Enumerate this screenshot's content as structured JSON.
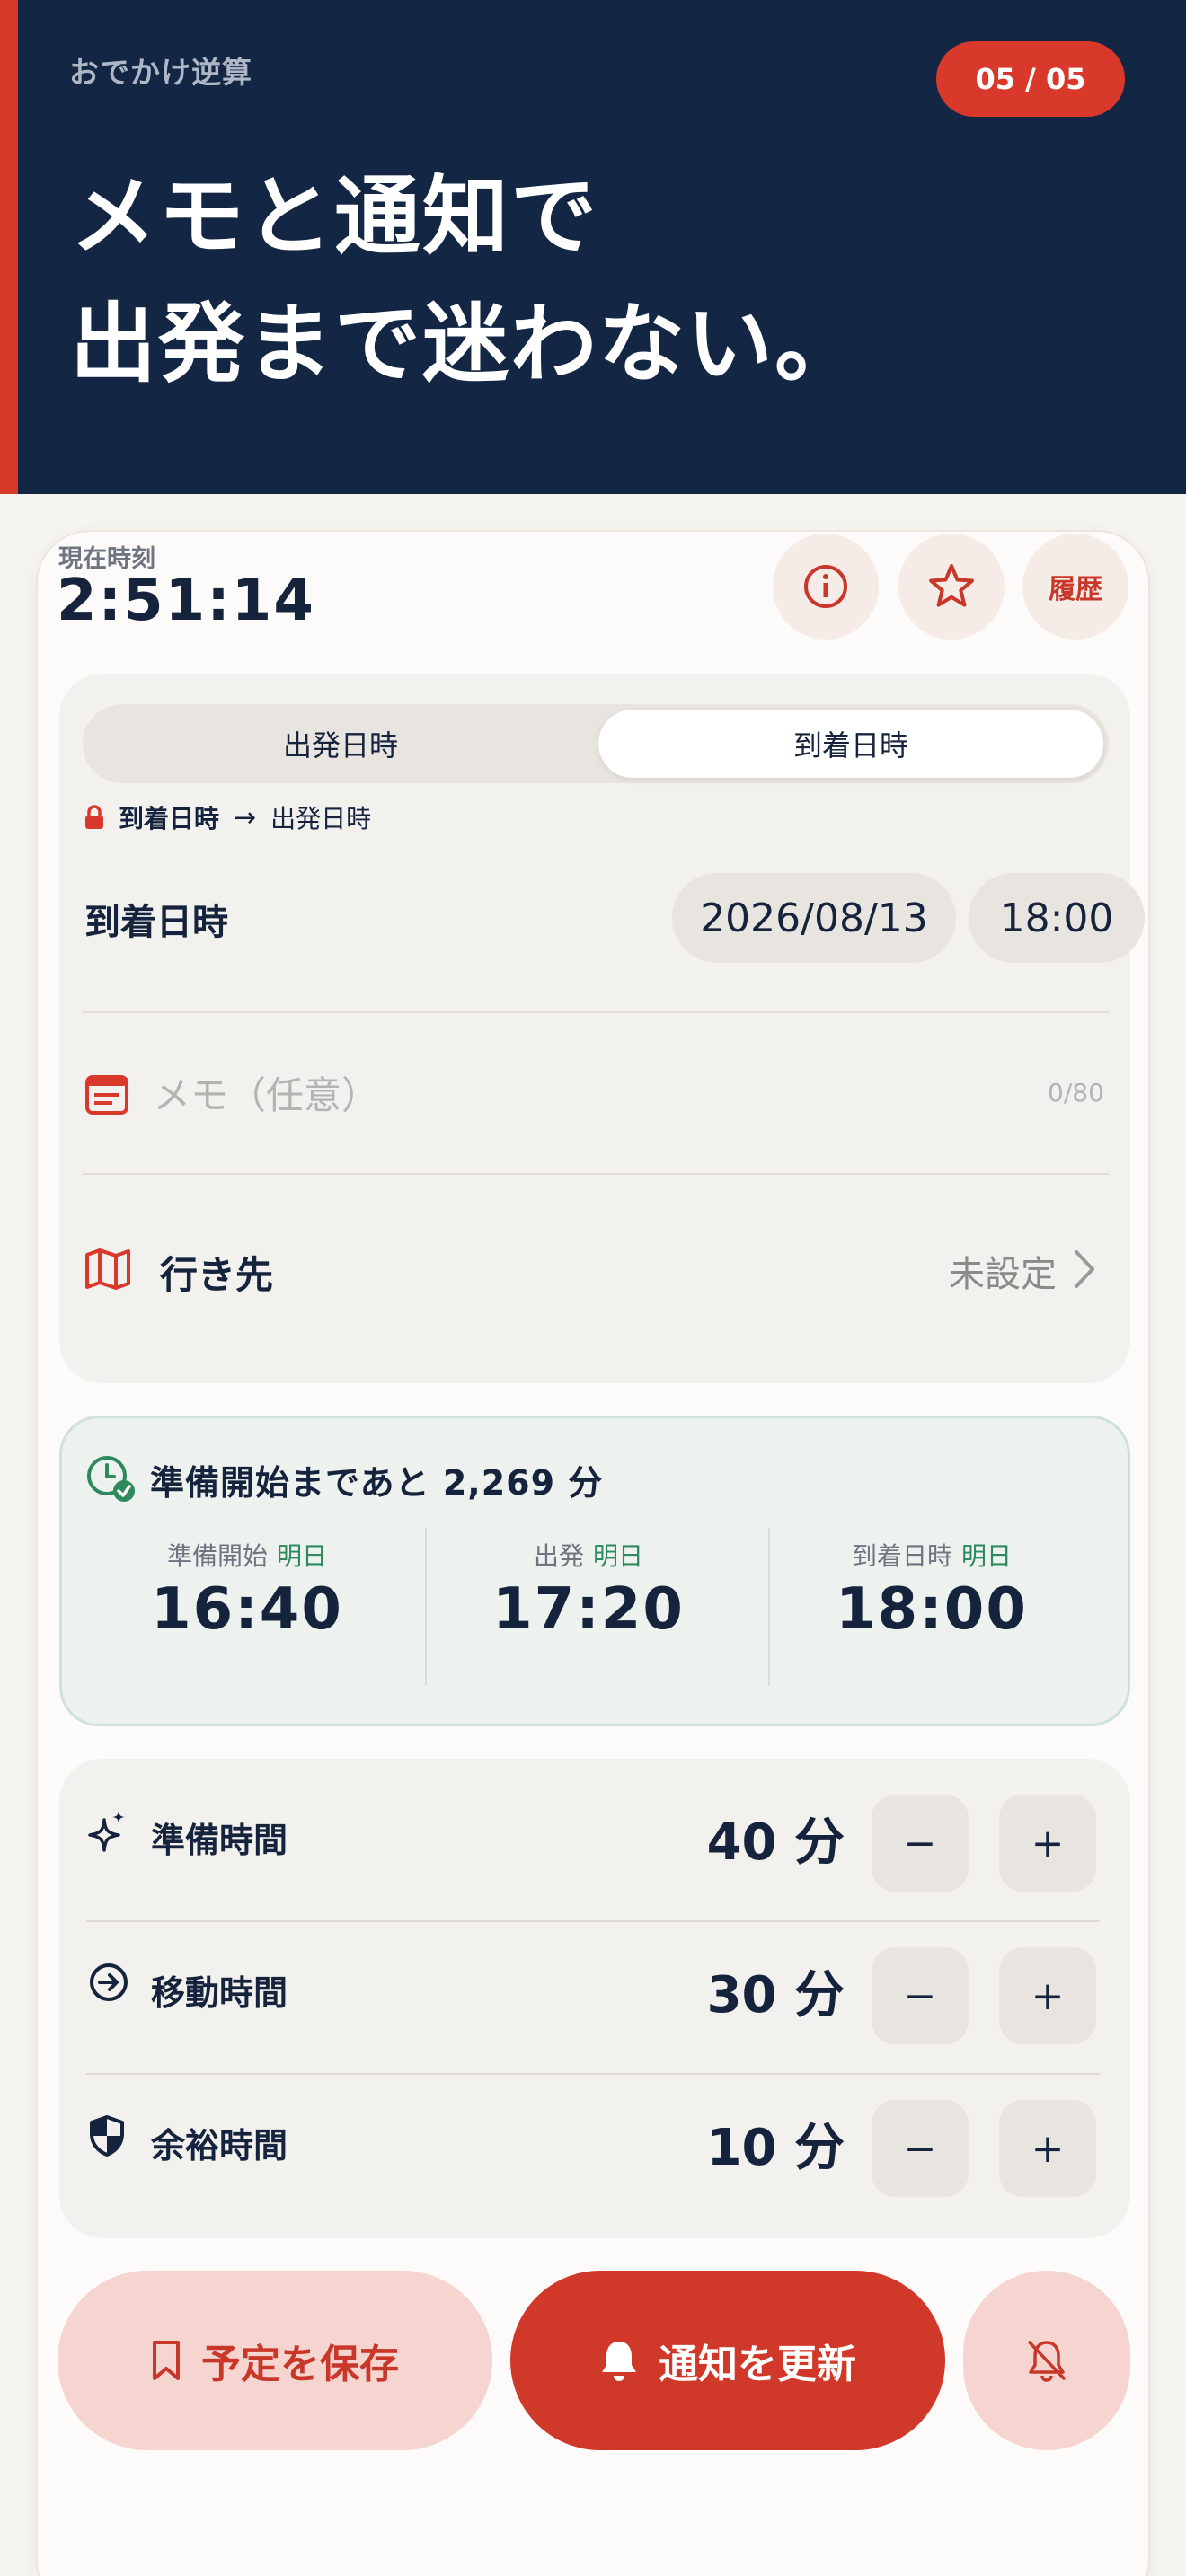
{
  "header": {
    "app_label": "おでかけ逆算",
    "page_badge": "05 / 05",
    "headline_line1": "メモと通知で",
    "headline_line2": "出発まで迷わない。"
  },
  "clock": {
    "label": "現在時刻",
    "value": "2:51:14"
  },
  "top_buttons": {
    "history_label": "履歴",
    "info_icon": "info-icon",
    "favorite_icon": "star-icon"
  },
  "mode": {
    "options": [
      "出発日時",
      "到着日時"
    ],
    "selected": "到着日時",
    "lock_from": "到着日時",
    "lock_to": "出発日時"
  },
  "datetime": {
    "label": "到着日時",
    "date": "2026/08/13",
    "time": "18:00"
  },
  "memo": {
    "placeholder": "メモ（任意）",
    "counter": "0/80"
  },
  "destination": {
    "label": "行き先",
    "value": "未設定"
  },
  "summary": {
    "headline": "準備開始まであと 2,269 分",
    "columns": [
      {
        "label": "準備開始",
        "tag": "明日",
        "time": "16:40"
      },
      {
        "label": "出発",
        "tag": "明日",
        "time": "17:20"
      },
      {
        "label": "到着日時",
        "tag": "明日",
        "time": "18:00"
      }
    ]
  },
  "durations": [
    {
      "name": "準備時間",
      "value": "40 分",
      "icon": "sparkle-icon"
    },
    {
      "name": "移動時間",
      "value": "30 分",
      "icon": "arrow-circle-icon"
    },
    {
      "name": "余裕時間",
      "value": "10 分",
      "icon": "shield-icon"
    }
  ],
  "stepper": {
    "minus": "−",
    "plus": "+"
  },
  "actions": {
    "save_label": "予定を保存",
    "notify_label": "通知を更新"
  },
  "colors": {
    "navy": "#132643",
    "accent": "#d8392a",
    "green": "#2e8a5c"
  }
}
